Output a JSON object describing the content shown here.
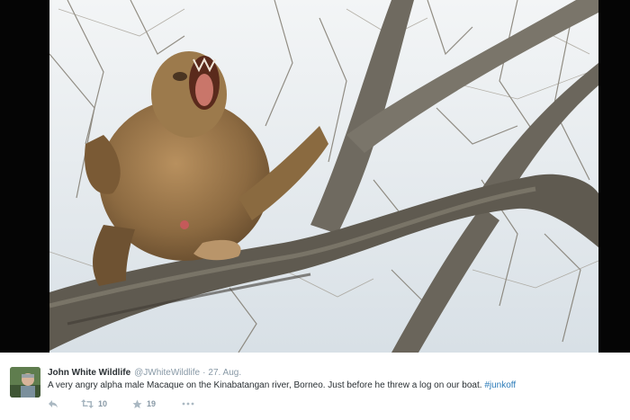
{
  "photo": {
    "icon": "macaque-photo"
  },
  "tweet": {
    "author_name": "John White Wildlife",
    "handle": "@JWhiteWildlife",
    "separator": "·",
    "date": "27. Aug.",
    "text": "A very angry alpha male Macaque on the Kinabatangan river, Borneo. Just before he threw a log on our boat.",
    "hashtag": "#junkoff",
    "actions": {
      "reply_icon": "reply-icon",
      "retweet_icon": "retweet-icon",
      "retweet_count": "10",
      "favorite_icon": "star-icon",
      "favorite_count": "19",
      "more_icon": "more-icon"
    }
  },
  "colors": {
    "link": "#2b7bb9",
    "muted": "#8899a6",
    "text": "#292f33"
  }
}
